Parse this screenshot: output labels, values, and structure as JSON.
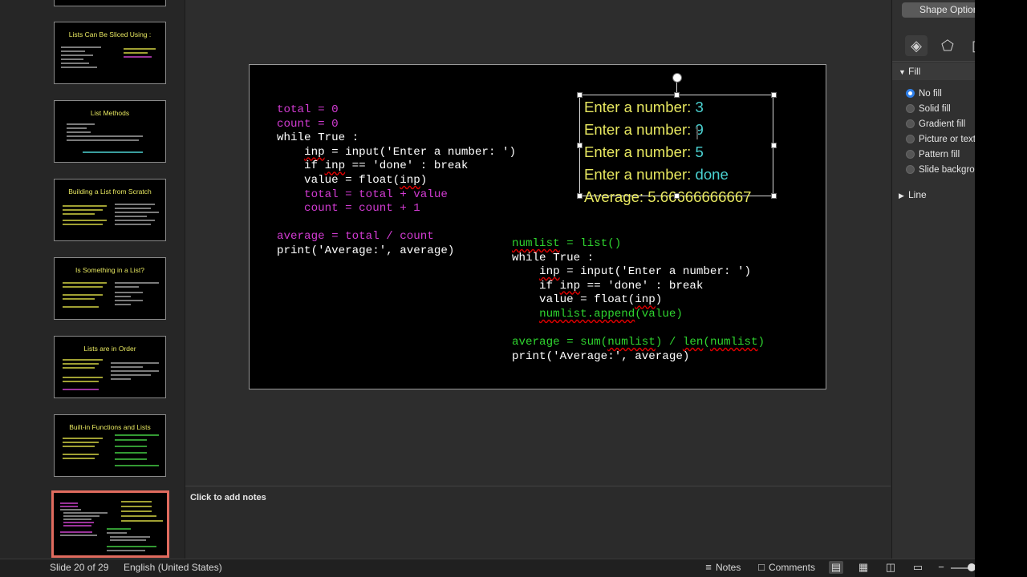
{
  "thumbnails": [
    {
      "title": ""
    },
    {
      "title": "Lists Can Be Sliced Using :"
    },
    {
      "title": "List Methods"
    },
    {
      "title": "Building a List from Scratch"
    },
    {
      "title": "Is Something in a List?"
    },
    {
      "title": "Lists are in Order"
    },
    {
      "title": "Built-in Functions and Lists"
    },
    {
      "title": ""
    }
  ],
  "slide": {
    "code1": {
      "l1": "total = 0",
      "l2": "count = 0",
      "l3": "while True :",
      "l4a": "    ",
      "l4b": "inp",
      "l4c": " = input('Enter a number: ')",
      "l5a": "    if ",
      "l5b": "inp",
      "l5c": " == 'done' : break",
      "l6a": "    value = float(",
      "l6b": "inp",
      "l6c": ")",
      "l7": "    total = total + value",
      "l8": "    count = count + 1",
      "l10": "average = total / count",
      "l11": "print('Average:', average)"
    },
    "code2": {
      "l1a": "numlist",
      "l1b": " = list()",
      "l2": "while True :",
      "l3a": "    ",
      "l3b": "inp",
      "l3c": " = input('Enter a number: ')",
      "l4a": "    if ",
      "l4b": "inp",
      "l4c": " == 'done' : break",
      "l5a": "    value = float(",
      "l5b": "inp",
      "l5c": ")",
      "l6a": "    ",
      "l6b": "numlist.append",
      "l6c": "(value)",
      "l8a": "average = sum(",
      "l8b": "numlist",
      "l8c": ") / ",
      "l8d": "len",
      "l8e": "(",
      "l8f": "numlist",
      "l8g": ")",
      "l9": "print('Average:', average)"
    },
    "output": [
      {
        "label": "Enter a number: ",
        "value": "3"
      },
      {
        "label": "Enter a number: ",
        "value": "9"
      },
      {
        "label": "Enter a number: ",
        "value": "5"
      },
      {
        "label": "Enter a number: ",
        "value": "done"
      },
      {
        "label": "Average: 5.66666666667",
        "value": ""
      }
    ]
  },
  "notes": {
    "placeholder": "Click to add notes"
  },
  "pane": {
    "title": "Shape Options",
    "fill_section": "Fill",
    "fill_options": [
      "No fill",
      "Solid fill",
      "Gradient fill",
      "Picture or texture fill",
      "Pattern fill",
      "Slide background fill"
    ],
    "selected_fill": "No fill",
    "line_section": "Line"
  },
  "status": {
    "slide_info": "Slide 20 of 29",
    "language": "English (United States)",
    "notes_label": "Notes",
    "comments_label": "Comments"
  },
  "colors": {
    "accent_selected": "#e06b5e",
    "radio_on": "#2f7fe8",
    "code_magenta": "#d23bd2",
    "code_green": "#2fd52f",
    "output_yellow": "#e8e860",
    "output_cyan": "#4ad0d0"
  },
  "icons": [
    "fill-line-icon",
    "effects-pentagon-icon",
    "size-icon",
    "notes-icon",
    "comments-icon",
    "normal-view-icon",
    "slide-sorter-icon",
    "reading-view-icon",
    "slideshow-icon",
    "zoom-out-icon"
  ]
}
